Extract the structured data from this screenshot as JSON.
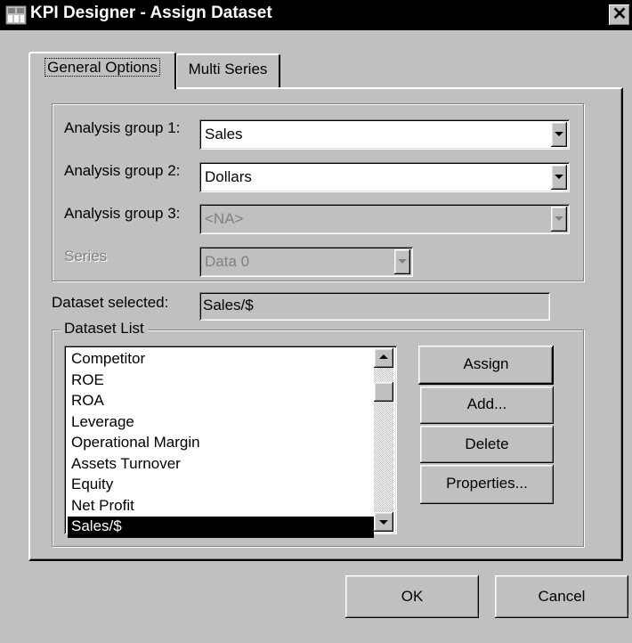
{
  "window": {
    "title": "KPI Designer - Assign Dataset",
    "close_glyph": "✕"
  },
  "tabs": [
    {
      "label": "General Options",
      "active": true
    },
    {
      "label": "Multi Series",
      "active": false
    }
  ],
  "analysis": {
    "group1": {
      "label": "Analysis group 1:",
      "value": "Sales",
      "enabled": true
    },
    "group2": {
      "label": "Analysis group 2:",
      "value": "Dollars",
      "enabled": true
    },
    "group3": {
      "label": "Analysis group 3:",
      "value": "<NA>",
      "enabled": false
    },
    "series": {
      "label": "Series",
      "value": "Data 0",
      "enabled": false
    }
  },
  "dataset_selected": {
    "label": "Dataset selected:",
    "value": "Sales/$"
  },
  "dataset_list": {
    "legend": "Dataset List",
    "items": [
      "Competitor",
      "ROE",
      "ROA",
      "Leverage",
      "Operational Margin",
      "Assets Turnover",
      "Equity",
      "Net Profit",
      "Sales/$"
    ],
    "selected_index": 8
  },
  "buttons": {
    "assign": "Assign",
    "add": "Add...",
    "delete": "Delete",
    "properties": "Properties...",
    "ok": "OK",
    "cancel": "Cancel"
  },
  "icons": {
    "app": "kpi-designer-app-icon",
    "close": "close-icon"
  }
}
